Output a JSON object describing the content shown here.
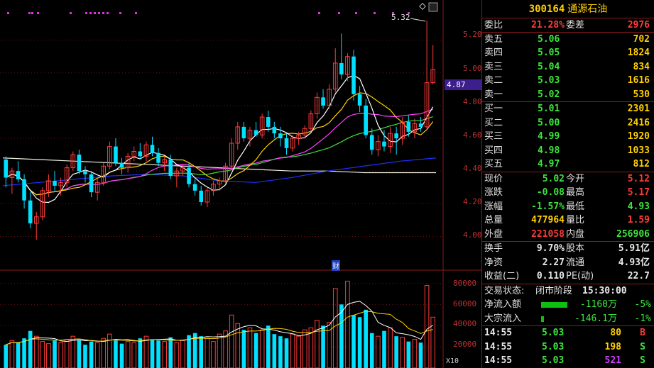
{
  "chart": {
    "price_ticks": [
      "5.20",
      "5.00",
      "4.80",
      "4.60",
      "4.40",
      "4.20",
      "4.00"
    ],
    "volume_ticks": [
      "80000",
      "60000",
      "40000",
      "20000"
    ],
    "volume_multiplier": "X10",
    "current_price_badge": "4.87",
    "peak_label": "5.32",
    "finance_marker": "财",
    "colors": {
      "up": "#ff3c3c",
      "down": "#00e0ff",
      "ma5": "#ffffff",
      "ma10": "#ffd000",
      "ma20": "#ff40ff",
      "ma30": "#40e040",
      "ma60": "#2030ff",
      "ma120": "#f0f0e0"
    }
  },
  "chart_data": {
    "type": "candlestick",
    "ylim": [
      3.95,
      5.35
    ],
    "volume_ylim": [
      0,
      85000
    ],
    "candles": [
      [
        4.47,
        4.49,
        4.3,
        4.36
      ],
      [
        4.36,
        4.42,
        4.26,
        4.4
      ],
      [
        4.4,
        4.46,
        4.33,
        4.35
      ],
      [
        4.35,
        4.38,
        4.17,
        4.22
      ],
      [
        4.22,
        4.27,
        4.05,
        4.08
      ],
      [
        4.08,
        4.15,
        3.98,
        4.12
      ],
      [
        4.12,
        4.3,
        4.1,
        4.28
      ],
      [
        4.28,
        4.38,
        4.24,
        4.34
      ],
      [
        4.34,
        4.4,
        4.28,
        4.31
      ],
      [
        4.31,
        4.36,
        4.25,
        4.33
      ],
      [
        4.33,
        4.44,
        4.3,
        4.42
      ],
      [
        4.42,
        4.52,
        4.4,
        4.5
      ],
      [
        4.5,
        4.53,
        4.38,
        4.4
      ],
      [
        4.4,
        4.43,
        4.33,
        4.38
      ],
      [
        4.38,
        4.4,
        4.24,
        4.27
      ],
      [
        4.27,
        4.35,
        4.22,
        4.33
      ],
      [
        4.33,
        4.45,
        4.31,
        4.43
      ],
      [
        4.43,
        4.58,
        4.41,
        4.55
      ],
      [
        4.55,
        4.6,
        4.43,
        4.45
      ],
      [
        4.45,
        4.48,
        4.38,
        4.42
      ],
      [
        4.42,
        4.51,
        4.39,
        4.49
      ],
      [
        4.49,
        4.55,
        4.46,
        4.52
      ],
      [
        4.52,
        4.57,
        4.47,
        4.49
      ],
      [
        4.49,
        4.58,
        4.46,
        4.56
      ],
      [
        4.56,
        4.61,
        4.49,
        4.51
      ],
      [
        4.51,
        4.54,
        4.43,
        4.45
      ],
      [
        4.45,
        4.49,
        4.4,
        4.47
      ],
      [
        4.47,
        4.5,
        4.35,
        4.37
      ],
      [
        4.37,
        4.42,
        4.3,
        4.4
      ],
      [
        4.4,
        4.44,
        4.37,
        4.42
      ],
      [
        4.42,
        4.45,
        4.3,
        4.32
      ],
      [
        4.32,
        4.35,
        4.25,
        4.28
      ],
      [
        4.28,
        4.31,
        4.19,
        4.21
      ],
      [
        4.21,
        4.3,
        4.18,
        4.28
      ],
      [
        4.28,
        4.34,
        4.25,
        4.32
      ],
      [
        4.32,
        4.36,
        4.28,
        4.34
      ],
      [
        4.34,
        4.45,
        4.32,
        4.43
      ],
      [
        4.43,
        4.6,
        4.41,
        4.57
      ],
      [
        4.57,
        4.7,
        4.53,
        4.67
      ],
      [
        4.67,
        4.7,
        4.58,
        4.6
      ],
      [
        4.6,
        4.67,
        4.55,
        4.65
      ],
      [
        4.65,
        4.7,
        4.61,
        4.62
      ],
      [
        4.62,
        4.75,
        4.6,
        4.73
      ],
      [
        4.73,
        4.77,
        4.64,
        4.67
      ],
      [
        4.67,
        4.7,
        4.6,
        4.63
      ],
      [
        4.63,
        4.67,
        4.55,
        4.6
      ],
      [
        4.6,
        4.63,
        4.5,
        4.54
      ],
      [
        4.54,
        4.62,
        4.52,
        4.6
      ],
      [
        4.6,
        4.64,
        4.56,
        4.62
      ],
      [
        4.62,
        4.68,
        4.6,
        4.66
      ],
      [
        4.66,
        4.77,
        4.64,
        4.75
      ],
      [
        4.75,
        4.88,
        4.72,
        4.85
      ],
      [
        4.85,
        4.9,
        4.78,
        4.8
      ],
      [
        4.8,
        4.93,
        4.78,
        4.9
      ],
      [
        4.9,
        5.15,
        4.88,
        5.06
      ],
      [
        5.06,
        5.24,
        4.96,
        4.99
      ],
      [
        4.99,
        5.12,
        4.95,
        5.1
      ],
      [
        5.1,
        5.14,
        4.83,
        4.87
      ],
      [
        4.87,
        4.92,
        4.76,
        4.8
      ],
      [
        4.8,
        4.84,
        4.6,
        4.62
      ],
      [
        4.62,
        4.66,
        4.5,
        4.53
      ],
      [
        4.53,
        4.62,
        4.49,
        4.58
      ],
      [
        4.58,
        4.65,
        4.52,
        4.55
      ],
      [
        4.55,
        4.67,
        4.51,
        4.63
      ],
      [
        4.63,
        4.67,
        4.5,
        4.6
      ],
      [
        4.6,
        4.73,
        4.56,
        4.7
      ],
      [
        4.7,
        4.74,
        4.61,
        4.64
      ],
      [
        4.64,
        4.72,
        4.6,
        4.69
      ],
      [
        4.69,
        4.73,
        4.64,
        4.67
      ],
      [
        4.67,
        5.32,
        4.66,
        4.94
      ],
      [
        4.94,
        5.17,
        4.93,
        5.02
      ]
    ],
    "volumes": [
      22000,
      26000,
      24000,
      28000,
      35000,
      30000,
      25000,
      23000,
      26000,
      24000,
      27000,
      30000,
      26000,
      22000,
      25000,
      24000,
      28000,
      32000,
      26000,
      23000,
      25000,
      24000,
      28000,
      30000,
      27000,
      26000,
      25000,
      29000,
      24000,
      26000,
      31000,
      33000,
      30000,
      28000,
      25000,
      32000,
      35000,
      50000,
      42000,
      36000,
      38000,
      33000,
      36000,
      40000,
      32000,
      30000,
      28000,
      32000,
      30000,
      36000,
      38000,
      45000,
      40000,
      43000,
      75000,
      60000,
      82000,
      50000,
      48000,
      55000,
      33000,
      30000,
      35000,
      38000,
      30000,
      29000,
      25000,
      27000,
      24000,
      78000,
      48000
    ]
  },
  "panel": {
    "code": "300164",
    "name": "通源石油",
    "weibi_label": "委比",
    "weibi_value": "21.28%",
    "weicha_label": "委差",
    "weicha_value": "2976",
    "asks": [
      {
        "label": "卖五",
        "price": "5.06",
        "vol": "702"
      },
      {
        "label": "卖四",
        "price": "5.05",
        "vol": "1824"
      },
      {
        "label": "卖三",
        "price": "5.04",
        "vol": "834"
      },
      {
        "label": "卖二",
        "price": "5.03",
        "vol": "1616"
      },
      {
        "label": "卖一",
        "price": "5.02",
        "vol": "530"
      }
    ],
    "bids": [
      {
        "label": "买一",
        "price": "5.01",
        "vol": "2301"
      },
      {
        "label": "买二",
        "price": "5.00",
        "vol": "2416"
      },
      {
        "label": "买三",
        "price": "4.99",
        "vol": "1920"
      },
      {
        "label": "买四",
        "price": "4.98",
        "vol": "1033"
      },
      {
        "label": "买五",
        "price": "4.97",
        "vol": "812"
      }
    ],
    "stats": [
      {
        "l1": "现价",
        "v1": "5.02",
        "c1": "green",
        "l2": "今开",
        "v2": "5.12",
        "c2": "red"
      },
      {
        "l1": "涨跌",
        "v1": "-0.08",
        "c1": "green",
        "l2": "最高",
        "v2": "5.17",
        "c2": "red"
      },
      {
        "l1": "涨幅",
        "v1": "-1.57%",
        "c1": "green",
        "l2": "最低",
        "v2": "4.93",
        "c2": "green"
      },
      {
        "l1": "总量",
        "v1": "477964",
        "c1": "yellow",
        "l2": "量比",
        "v2": "1.59",
        "c2": "red"
      },
      {
        "l1": "外盘",
        "v1": "221058",
        "c1": "red",
        "l2": "内盘",
        "v2": "256906",
        "c2": "green"
      }
    ],
    "fundamentals": [
      {
        "l1": "换手",
        "v1": "9.70%",
        "l2": "股本",
        "v2": "5.91亿"
      },
      {
        "l1": "净资",
        "v1": "2.27",
        "l2": "流通",
        "v2": "4.93亿"
      },
      {
        "l1": "收益(二)",
        "v1": "0.110",
        "l2": "PE(动)",
        "v2": "22.7"
      }
    ],
    "trade_status_label": "交易状态:",
    "trade_status_value": "闭市阶段",
    "trade_status_time": "15:30:00",
    "flows": [
      {
        "label": "净流入额",
        "value": "-1160万",
        "pct": "-5%",
        "bar": 0.85
      },
      {
        "label": "大宗流入",
        "value": "-146.1万",
        "pct": "-1%",
        "bar": 0.1
      }
    ],
    "ticks": [
      {
        "time": "14:55",
        "price": "5.03",
        "vol": "80",
        "side": "B",
        "vc": "yellow",
        "sc": "red"
      },
      {
        "time": "14:55",
        "price": "5.03",
        "vol": "198",
        "side": "S",
        "vc": "yellow",
        "sc": "green"
      },
      {
        "time": "14:55",
        "price": "5.03",
        "vol": "521",
        "side": "S",
        "vc": "purple",
        "sc": "green"
      }
    ]
  }
}
